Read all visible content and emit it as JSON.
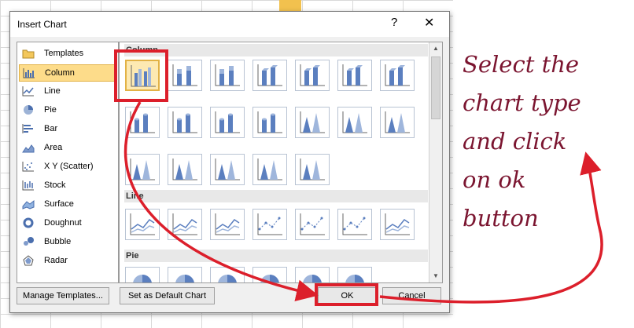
{
  "dialog": {
    "title": "Insert Chart",
    "help_glyph": "?",
    "close_glyph": "✕"
  },
  "chart_types": [
    {
      "label": "Templates",
      "icon": "folder-icon",
      "selected": false
    },
    {
      "label": "Column",
      "icon": "column-chart-icon",
      "selected": true
    },
    {
      "label": "Line",
      "icon": "line-chart-icon",
      "selected": false
    },
    {
      "label": "Pie",
      "icon": "pie-chart-icon",
      "selected": false
    },
    {
      "label": "Bar",
      "icon": "bar-chart-icon",
      "selected": false
    },
    {
      "label": "Area",
      "icon": "area-chart-icon",
      "selected": false
    },
    {
      "label": "X Y (Scatter)",
      "icon": "scatter-chart-icon",
      "selected": false
    },
    {
      "label": "Stock",
      "icon": "stock-chart-icon",
      "selected": false
    },
    {
      "label": "Surface",
      "icon": "surface-chart-icon",
      "selected": false
    },
    {
      "label": "Doughnut",
      "icon": "doughnut-chart-icon",
      "selected": false
    },
    {
      "label": "Bubble",
      "icon": "bubble-chart-icon",
      "selected": false
    },
    {
      "label": "Radar",
      "icon": "radar-chart-icon",
      "selected": false
    }
  ],
  "gallery": {
    "sections": [
      {
        "title": "Column"
      },
      {
        "title": "Line"
      },
      {
        "title": "Pie"
      }
    ]
  },
  "buttons": {
    "manage_templates": "Manage Templates...",
    "set_default": "Set as Default Chart",
    "ok": "OK",
    "cancel": "Cancel"
  },
  "annotation": {
    "lines": [
      "Select the",
      "chart type",
      "and click",
      "on ok",
      "button"
    ],
    "color": "#7b1530",
    "highlight_color": "#dc1f2b"
  }
}
